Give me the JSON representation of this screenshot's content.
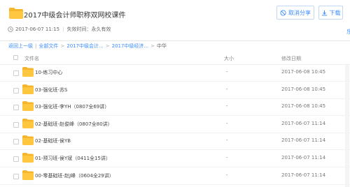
{
  "share": {
    "title": "2017中级会计师职称双网校课件",
    "date": "2017-06-07 11:15",
    "expiry": "失效时间：永久有效"
  },
  "actions": {
    "cancel_share": "取消分享",
    "download": "下载",
    "more": "乐"
  },
  "breadcrumb": {
    "back": "返回上一级",
    "all": "全部文件",
    "level1": "2017中级会计...",
    "level2": "2017中级经济...",
    "current": "中华"
  },
  "table": {
    "col_name": "文件名",
    "col_size": "大小",
    "col_date": "修改日期",
    "rows": [
      {
        "name": "10-练习中心",
        "size": "-",
        "date": "2017-06-08 10:45"
      },
      {
        "name": "03-强化班-苏S",
        "size": "-",
        "date": "2017-06-08 10:45"
      },
      {
        "name": "03-强化班-李YH（0807全69讲）",
        "size": "-",
        "date": "2017-06-08 10:45"
      },
      {
        "name": "02-基础班-赵俊峰（0807全80讲）",
        "size": "-",
        "date": "2017-06-07 11:14"
      },
      {
        "name": "02-基础班-侯YB",
        "size": "-",
        "date": "2017-06-07 11:14"
      },
      {
        "name": "01-预习班-侯Y斌（0411全15讲）",
        "size": "-",
        "date": "2017-06-07 11:14"
      },
      {
        "name": "00-零基础班-赵J峰（0604全29讲）",
        "size": "-",
        "date": "2017-06-07 11:14"
      }
    ]
  },
  "colors": {
    "accent": "#3b8cff",
    "folder": "#ffc740",
    "folder_tab": "#f5b52d"
  }
}
